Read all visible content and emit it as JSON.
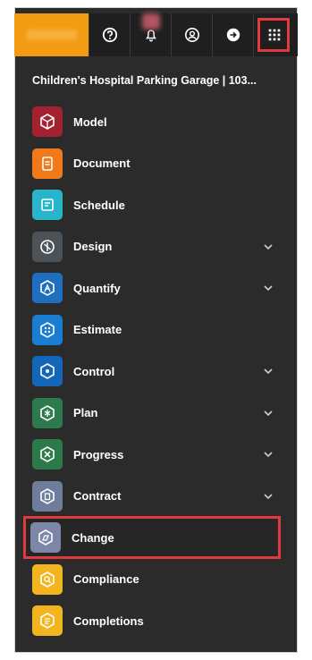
{
  "topbar": {
    "buttons": [
      {
        "icon": "help-icon"
      },
      {
        "icon": "notifications-icon"
      },
      {
        "icon": "account-icon"
      },
      {
        "icon": "logout-icon"
      },
      {
        "icon": "apps-grid-icon",
        "active": true
      }
    ]
  },
  "project": {
    "title": "Children's Hospital Parking Garage | 103..."
  },
  "menu": {
    "items": [
      {
        "label": "Model",
        "color": "#a3222f",
        "icon": "model-icon",
        "expandable": false
      },
      {
        "label": "Document",
        "color": "#f07a1a",
        "icon": "document-icon",
        "expandable": false
      },
      {
        "label": "Schedule",
        "color": "#29b5c9",
        "icon": "schedule-icon",
        "expandable": false
      },
      {
        "label": "Design",
        "color": "#4c5358",
        "icon": "design-icon",
        "expandable": true
      },
      {
        "label": "Quantify",
        "color": "#1f6fc1",
        "icon": "quantify-icon",
        "expandable": true
      },
      {
        "label": "Estimate",
        "color": "#1a7dd1",
        "icon": "estimate-icon",
        "expandable": false
      },
      {
        "label": "Control",
        "color": "#1466b8",
        "icon": "control-icon",
        "expandable": true
      },
      {
        "label": "Plan",
        "color": "#2e7a4f",
        "icon": "plan-icon",
        "expandable": true
      },
      {
        "label": "Progress",
        "color": "#2c7a4a",
        "icon": "progress-icon",
        "expandable": true
      },
      {
        "label": "Contract",
        "color": "#6f7d9c",
        "icon": "contract-icon",
        "expandable": true
      },
      {
        "label": "Change",
        "color": "#7d86a6",
        "icon": "change-icon",
        "expandable": false,
        "selected": true
      },
      {
        "label": "Compliance",
        "color": "#f2b51f",
        "icon": "compliance-icon",
        "expandable": false
      },
      {
        "label": "Completions",
        "color": "#f2b51f",
        "icon": "completions-icon",
        "expandable": false
      }
    ]
  }
}
